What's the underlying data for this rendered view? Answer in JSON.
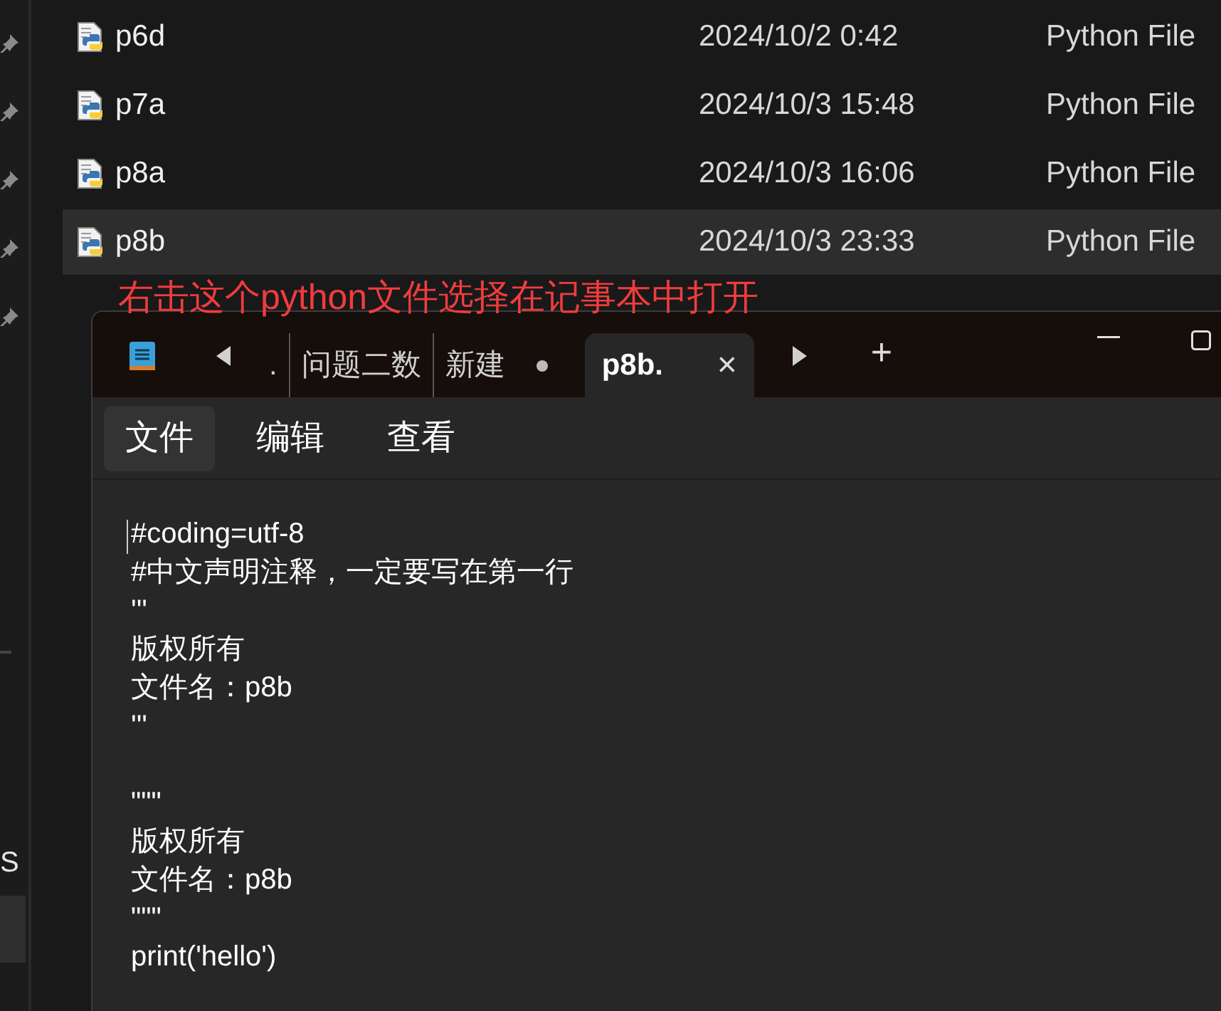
{
  "explorer": {
    "pins": [
      {
        "pinned": true
      },
      {
        "pinned": true
      },
      {
        "pinned": true
      },
      {
        "pinned": true
      },
      {
        "pinned": true
      }
    ],
    "nav_label": "S",
    "files": [
      {
        "name": "p6d",
        "date": "2024/10/2 0:42",
        "type": "Python File",
        "selected": false
      },
      {
        "name": "p7a",
        "date": "2024/10/3 15:48",
        "type": "Python File",
        "selected": false
      },
      {
        "name": "p8a",
        "date": "2024/10/3 16:06",
        "type": "Python File",
        "selected": false
      },
      {
        "name": "p8b",
        "date": "2024/10/3 23:33",
        "type": "Python File",
        "selected": true
      }
    ]
  },
  "annotation": "右击这个python文件选择在记事本中打开",
  "notepad": {
    "tabs": [
      {
        "label": ".",
        "selected": false,
        "modified": false
      },
      {
        "label": "问题二数",
        "selected": false,
        "modified": false
      },
      {
        "label": "新建",
        "selected": false,
        "modified": true
      },
      {
        "label": "p8b.",
        "selected": true,
        "modified": false
      }
    ],
    "tab_close": "×",
    "new_tab": "+",
    "menu": [
      {
        "label": "文件",
        "selected": true
      },
      {
        "label": "编辑",
        "selected": false
      },
      {
        "label": "查看",
        "selected": false
      }
    ],
    "blocks": [
      [
        "#coding=utf-8",
        "#中文声明注释，一定要写在第一行",
        "'''",
        "版权所有",
        "文件名：p8b",
        "'''"
      ],
      [
        "\"\"\"",
        "版权所有",
        "文件名：p8b",
        "\"\"\"",
        "print('hello')"
      ]
    ]
  }
}
